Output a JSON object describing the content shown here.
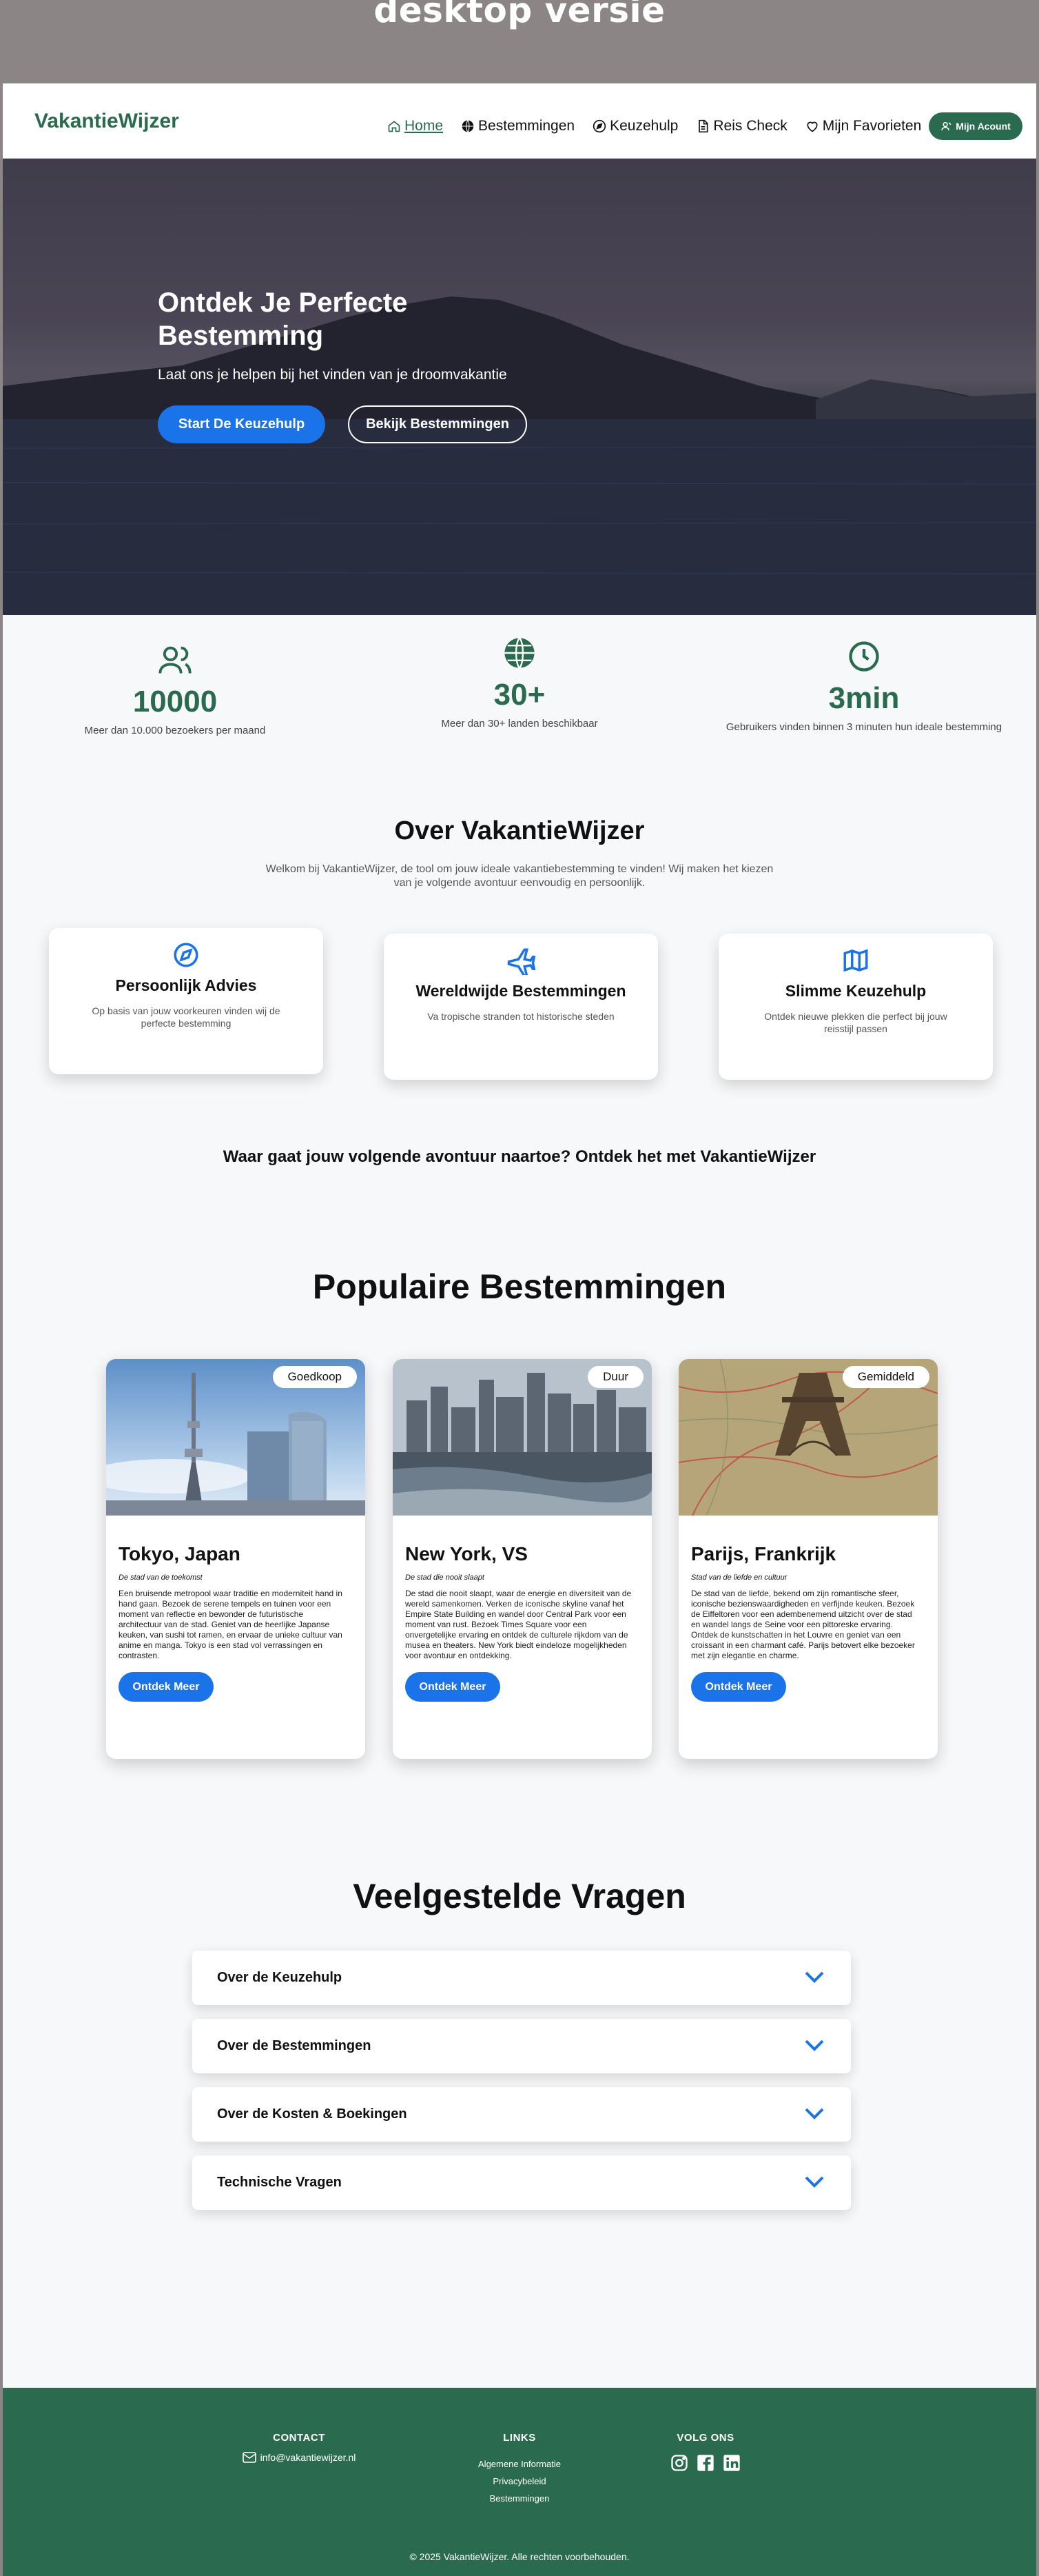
{
  "banner": {
    "title": "desktop versie"
  },
  "nav": {
    "brand": "VakantieWijzer",
    "links": [
      {
        "label": "Home",
        "icon": "home-icon",
        "active": true
      },
      {
        "label": "Bestemmingen",
        "icon": "globe-icon"
      },
      {
        "label": "Keuzehulp",
        "icon": "compass-icon"
      },
      {
        "label": "Reis Check",
        "icon": "document-icon"
      },
      {
        "label": "Mijn Favorieten",
        "icon": "heart-icon"
      }
    ],
    "account_label": "Mijn Acount"
  },
  "hero": {
    "title": "Ontdek Je Perfecte Bestemming",
    "subtitle": "Laat ons je helpen bij het vinden van je droomvakantie",
    "primary_button": "Start De Keuzehulp",
    "secondary_button": "Bekijk Bestemmingen"
  },
  "stats": [
    {
      "icon": "users-icon",
      "value": "10000",
      "label": "Meer dan 10.000 bezoekers per maand"
    },
    {
      "icon": "globe-icon",
      "value": "30+",
      "label": "Meer dan 30+ landen beschikbaar"
    },
    {
      "icon": "clock-icon",
      "value": "3min",
      "label": "Gebruikers vinden binnen 3 minuten hun ideale bestemming"
    }
  ],
  "about": {
    "title": "Over VakantieWijzer",
    "text": "Welkom bij VakantieWijzer, de tool om jouw ideale vakantiebestemming te vinden! Wij maken het kiezen van je volgende avontuur eenvoudig en persoonlijk.",
    "features": [
      {
        "icon": "compass-icon",
        "title": "Persoonlijk Advies",
        "text": "Op basis van jouw voorkeuren vinden wij de perfecte bestemming"
      },
      {
        "icon": "plane-icon",
        "title": "Wereldwijde Bestemmingen",
        "text": "Va tropische stranden tot historische steden"
      },
      {
        "icon": "map-icon",
        "title": "Slimme Keuzehulp",
        "text": "Ontdek nieuwe plekken die perfect bij jouw reisstijl passen"
      }
    ],
    "tagline": "Waar gaat jouw volgende avontuur naartoe? Ontdek het met VakantieWijzer"
  },
  "destinations": {
    "title": "Populaire Bestemmingen",
    "cards": [
      {
        "badge": "Goedkoop",
        "title": "Tokyo, Japan",
        "subtitle": "De stad van de toekomst",
        "text": "Een bruisende metropool waar traditie en moderniteit hand in hand gaan. Bezoek de serene tempels en tuinen voor een moment van reflectie en bewonder de futuristische architectuur van de stad. Geniet van de heerlijke Japanse keuken, van sushi tot ramen, en ervaar de unieke cultuur van anime en manga. Tokyo is een stad vol verrassingen en contrasten.",
        "button": "Ontdek Meer",
        "image": "tokyo-tower-photo"
      },
      {
        "badge": "Duur",
        "title": "New York, VS",
        "subtitle": "De stad die nooit slaapt",
        "text": "De stad die nooit slaapt, waar de energie en diversiteit van de wereld samenkomen. Verken de iconische skyline vanaf het Empire State Building en wandel door Central Park voor een moment van rust. Bezoek Times Square voor een onvergetelijke ervaring en ontdek de culturele rijkdom van de musea en theaters. New York biedt eindeloze mogelijkheden voor avontuur en ontdekking.",
        "button": "Ontdek Meer",
        "image": "manhattan-skyline-photo"
      },
      {
        "badge": "Gemiddeld",
        "title": "Parijs, Frankrijk",
        "subtitle": "Stad van de liefde en cultuur",
        "text": "De stad van de liefde, bekend om zijn romantische sfeer, iconische bezienswaardigheden en verfijnde keuken. Bezoek de Eiffeltoren voor een adembenemend uitzicht over de stad en wandel langs de Seine voor een pittoreske ervaring. Ontdek de kunstschatten in het Louvre en geniet van een croissant in een charmant café. Parijs betovert elke bezoeker met zijn elegantie en charme.",
        "button": "Ontdek Meer",
        "image": "eiffel-map-photo"
      }
    ]
  },
  "faq": {
    "title": "Veelgestelde Vragen",
    "items": [
      "Over de Keuzehulp",
      "Over de Bestemmingen",
      "Over de Kosten & Boekingen",
      "Technische Vragen"
    ]
  },
  "footer": {
    "contact_heading": "CONTACT",
    "email": "info@vakantiewijzer.nl",
    "links_heading": "LINKS",
    "links": [
      "Algemene Informatie",
      "Privacybeleid",
      "Bestemmingen"
    ],
    "social_heading": "VOLG ONS",
    "socials": [
      "instagram-icon",
      "facebook-icon",
      "linkedin-icon"
    ],
    "copyright": "© 2025 VakantieWijzer. Alle rechten voorbehouden."
  },
  "colors": {
    "brand_green": "#2a6b4f",
    "accent_blue": "#1a73e8",
    "faq_chevron": "#1a73e8"
  }
}
